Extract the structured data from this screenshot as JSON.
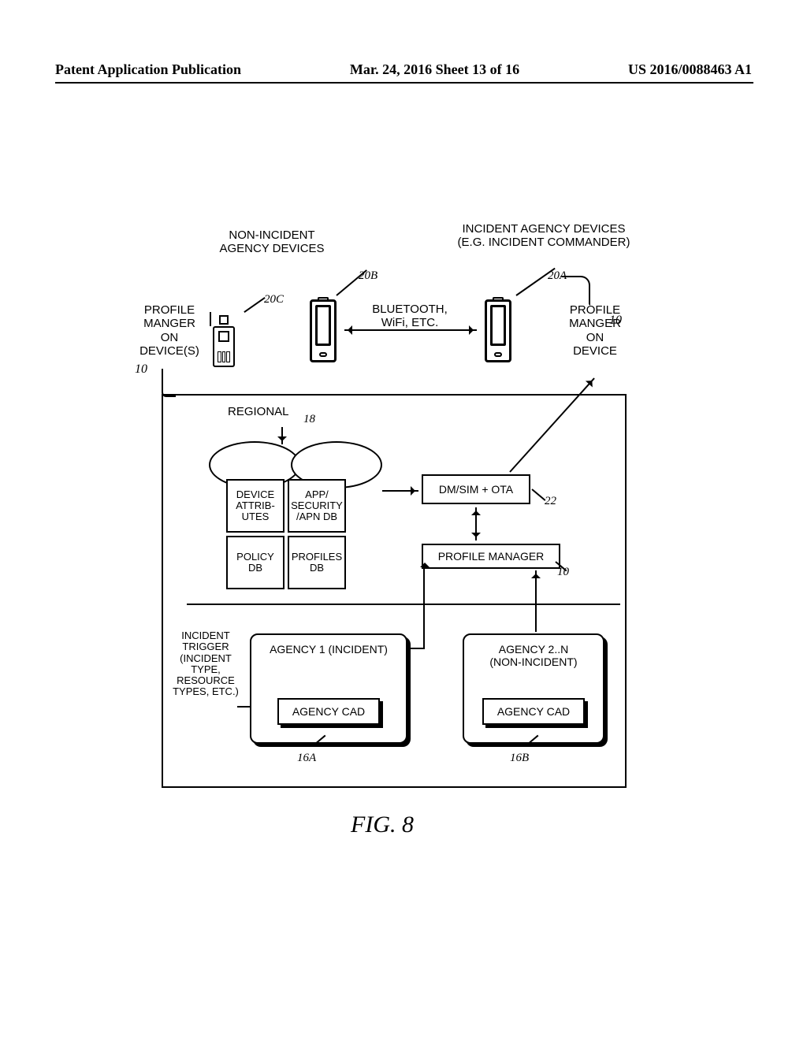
{
  "header": {
    "left": "Patent Application Publication",
    "center": "Mar. 24, 2016  Sheet 13 of 16",
    "right": "US 2016/0088463 A1"
  },
  "top": {
    "non_incident": "NON-INCIDENT\nAGENCY DEVICES",
    "incident": "INCIDENT AGENCY DEVICES\n(E.G. INCIDENT COMMANDER)",
    "bt": "BLUETOOTH,\nWiFi, ETC.",
    "pm_left": "PROFILE\nMANGER\nON\nDEVICE(S)",
    "pm_right": "PROFILE\nMANGER\nON\nDEVICE",
    "ref20A": "20A",
    "ref20B": "20B",
    "ref20C": "20C",
    "ref10": "10"
  },
  "regional": {
    "title": "REGIONAL",
    "ref18": "18",
    "db_devattr": "DEVICE\nATTRIB-\nUTES",
    "db_appsec": "APP/\nSECURITY\n/APN DB",
    "db_policy": "POLICY\nDB",
    "db_profiles": "PROFILES\nDB",
    "dmsim": "DM/SIM + OTA",
    "pmgr": "PROFILE MANAGER",
    "ref22": "22",
    "ref10": "10"
  },
  "agencies": {
    "trigger": "INCIDENT\nTRIGGER\n(INCIDENT\nTYPE,\nRESOURCE\nTYPES, ETC.)",
    "ag1": "AGENCY 1 (INCIDENT)",
    "ag2": "AGENCY 2..N\n(NON-INCIDENT)",
    "cad": "AGENCY CAD",
    "ref16A": "16A",
    "ref16B": "16B"
  },
  "caption": "FIG. 8"
}
